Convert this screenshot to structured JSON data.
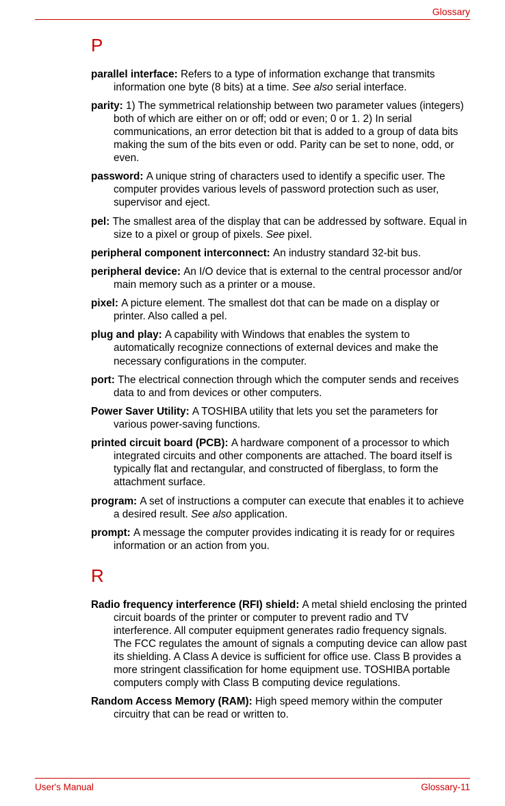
{
  "header": {
    "section": "Glossary"
  },
  "sections": {
    "P": {
      "letter": "P",
      "entries": {
        "parallel_interface": {
          "term": "parallel interface:  ",
          "def_a": "Refers to a type of information exchange that transmits information one byte (8 bits) at a time. ",
          "italic_a": "See also",
          "def_b": " serial interface."
        },
        "parity": {
          "term": "parity:  ",
          "def": "1) The symmetrical relationship between two parameter values (integers) both of which are either on or off; odd or even; 0 or 1. 2) In serial communications, an error detection bit that is added to a group of data bits making the sum of the bits even or odd. Parity can be set to none, odd, or even."
        },
        "password": {
          "term": "password:  ",
          "def": "A unique string of characters used to identify a specific user. The computer provides various levels of password protection such as user, supervisor and eject."
        },
        "pel": {
          "term": "pel:  ",
          "def_a": "The smallest area of the display that can be addressed by software. Equal in size to a pixel or group of pixels. ",
          "italic_a": "See",
          "def_b": " pixel."
        },
        "pci": {
          "term": "peripheral component interconnect:  ",
          "def": "An industry standard 32-bit bus."
        },
        "peripheral_device": {
          "term": "peripheral device:  ",
          "def": "An I/O device that is external to the central processor and/or main memory such as a printer or a mouse."
        },
        "pixel": {
          "term": "pixel:  ",
          "def": "A picture element. The smallest dot that can be made on a display or printer. Also called a pel."
        },
        "plug_and_play": {
          "term": "plug and play:  ",
          "def": "A capability with Windows that enables the system to automatically recognize connections of external devices and make the necessary configurations in the computer."
        },
        "port": {
          "term": "port:  ",
          "def": "The electrical connection through which the computer sends and receives data to and from devices or other computers."
        },
        "power_saver": {
          "term": "Power Saver Utility:  ",
          "def": "A TOSHIBA utility that lets you set the parameters for various power-saving functions."
        },
        "pcb": {
          "term": "printed circuit board (PCB):  ",
          "def": "A hardware component of a processor to which integrated circuits and other components are attached. The board itself is typically flat and rectangular, and constructed of fiberglass, to form the attachment surface."
        },
        "program": {
          "term": "program:  ",
          "def_a": "A set of instructions a computer can execute that enables it to achieve a desired result. ",
          "italic_a": "See also",
          "def_b": " application."
        },
        "prompt": {
          "term": "prompt:  ",
          "def": "A message the computer provides indicating it is ready for or requires information or an action from you."
        }
      }
    },
    "R": {
      "letter": "R",
      "entries": {
        "rfi": {
          "term": "Radio frequency interference (RFI) shield:  ",
          "def": "A metal shield enclosing the printed circuit boards of the printer or computer to prevent radio and TV interference. All computer equipment generates radio frequency signals. The FCC regulates the amount of signals a computing device can allow past its shielding. A Class A device is sufficient for office use. Class B provides a more stringent classification for home equipment use. TOSHIBA portable computers comply with Class B computing device regulations."
        },
        "ram": {
          "term": "Random Access Memory (RAM):  ",
          "def": "High speed memory within the computer circuitry that can be read or written to."
        }
      }
    }
  },
  "footer": {
    "left": "User's Manual",
    "right": "Glossary-11"
  }
}
